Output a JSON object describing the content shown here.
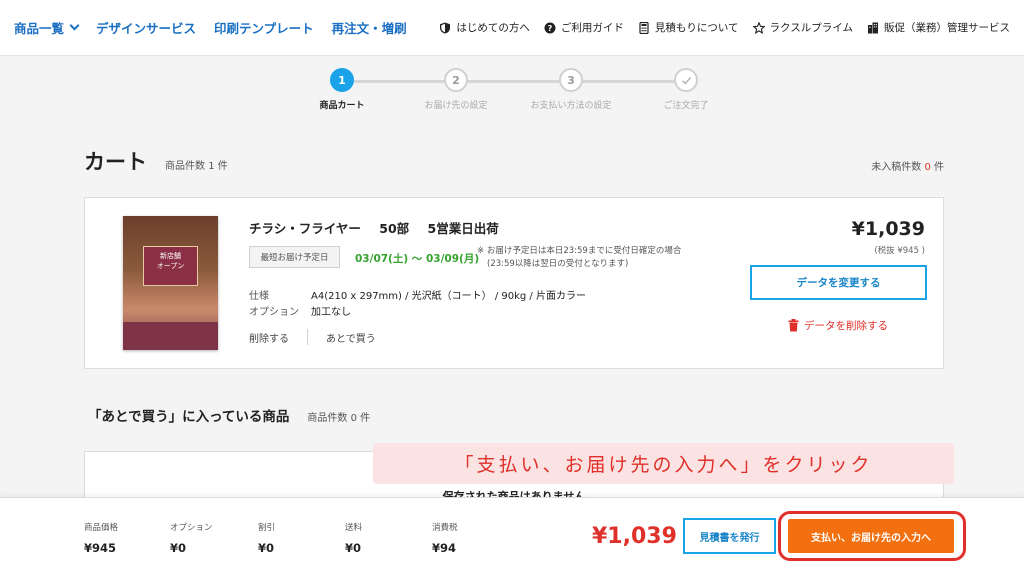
{
  "nav": {
    "products": "商品一覧",
    "design": "デザインサービス",
    "templates": "印刷テンプレート",
    "reorder": "再注文・増刷",
    "beginners": "はじめての方へ",
    "guide": "ご利用ガイド",
    "estimate": "見積もりについて",
    "prime": "ラクスルプライム",
    "sales": "販促（業務）管理サービス"
  },
  "stepper": {
    "steps": [
      {
        "num": "1",
        "label": "商品カート",
        "active": true
      },
      {
        "num": "2",
        "label": "お届け先の設定",
        "active": false
      },
      {
        "num": "3",
        "label": "お支払い方法の設定",
        "active": false
      },
      {
        "num": "",
        "label": "ご注文完了",
        "active": false
      }
    ]
  },
  "cart": {
    "title": "カート",
    "count_label": "商品件数",
    "count": "1",
    "count_unit": "件",
    "unentered_label": "未入稿件数",
    "unentered_count": "0",
    "unentered_unit": "件"
  },
  "item": {
    "name": "チラシ・フライヤー",
    "quantity": "50部",
    "shipping": "5営業日出荷",
    "thumb_text_1": "新店舗",
    "thumb_text_2": "オープン",
    "delivery_label": "最短お届け予定日",
    "delivery_dates": "03/07(土) 〜 03/09(月)",
    "delivery_note_1": "※ お届け予定日は本日23:59までに受付日確定の場合",
    "delivery_note_2": "(23:59以降は翌日の受付となります)",
    "spec_label": "仕様",
    "spec_value": "A4(210 x 297mm) / 光沢紙（コート） / 90kg / 片面カラー",
    "option_label": "オプション",
    "option_value": "加工なし",
    "delete": "削除する",
    "buy_later": "あとで買う",
    "price": "¥1,039",
    "price_excl": "(税抜 ¥945 )",
    "change_data": "データを変更する",
    "delete_data": "データを削除する"
  },
  "later": {
    "title": "「あとで買う」に入っている商品",
    "count_label": "商品件数",
    "count": "0",
    "count_unit": "件",
    "empty": "保存された商品はありません"
  },
  "annotation": "「支払い、お届け先の入力へ」をクリック",
  "summary": {
    "price_label": "商品価格",
    "price": "¥945",
    "option_label": "オプション",
    "option": "¥0",
    "discount_label": "割引",
    "discount": "¥0",
    "shipping_label": "送料",
    "shipping": "¥0",
    "tax_label": "消費税",
    "tax": "¥94",
    "total": "¥1,039",
    "quote_button": "見積書を発行",
    "proceed_button": "支払い、お届け先の入力へ"
  },
  "colors": {
    "brand_blue": "#1a6fc2",
    "step_active": "#1aa3e8",
    "accent_red": "#e0302a",
    "primary_orange": "#f2700f",
    "delivery_green": "#35a32e"
  }
}
